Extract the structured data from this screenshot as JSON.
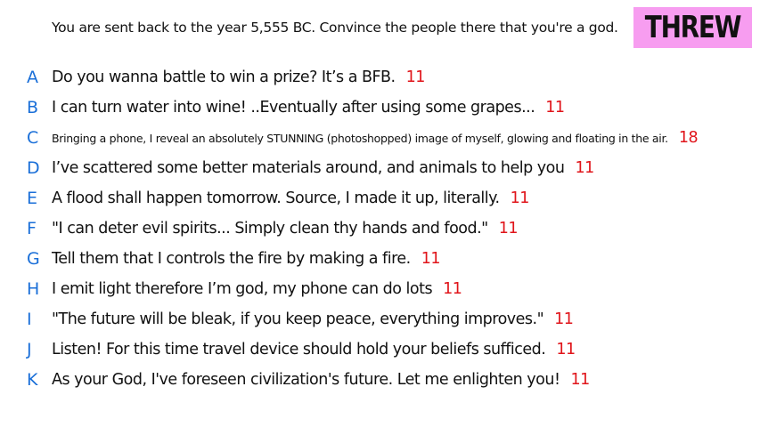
{
  "prompt": "You are sent back to the year 5,555 BC. Convince the people there that you're a god.",
  "badge": {
    "label": "THREW",
    "color": "#f79df0"
  },
  "colors": {
    "letter": "#1a6fd8",
    "score": "#e0141a",
    "text": "#111111"
  },
  "answers": [
    {
      "letter": "A",
      "text": "Do you wanna battle to win a prize? It’s a BFB.",
      "score": "11"
    },
    {
      "letter": "B",
      "text": "I can turn water into wine! ..Eventually after using some grapes...",
      "score": "11"
    },
    {
      "letter": "C",
      "text": "Bringing a phone, I reveal an absolutely STUNNING (photoshopped) image of myself, glowing and floating in the air.",
      "score": "18"
    },
    {
      "letter": "D",
      "text": "I’ve scattered some better materials around, and animals to help you",
      "score": "11"
    },
    {
      "letter": "E",
      "text": "A flood shall happen tomorrow. Source,  I made it up, literally.",
      "score": "11"
    },
    {
      "letter": "F",
      "text": "\"I can deter evil spirits... Simply clean thy hands and food.\"",
      "score": "11"
    },
    {
      "letter": "G",
      "text": "Tell them that I controls the fire by making a fire.",
      "score": "11"
    },
    {
      "letter": "H",
      "text": "I emit light therefore I’m god, my phone can do lots",
      "score": "11"
    },
    {
      "letter": "I",
      "text": "\"The future will be bleak, if you keep peace, everything improves.\"",
      "score": "11"
    },
    {
      "letter": "J",
      "text": "Listen! For this time travel device should hold your beliefs sufficed.",
      "score": "11"
    },
    {
      "letter": "K",
      "text": "As your God, I've foreseen civilization's future. Let me enlighten you!",
      "score": "11"
    }
  ]
}
